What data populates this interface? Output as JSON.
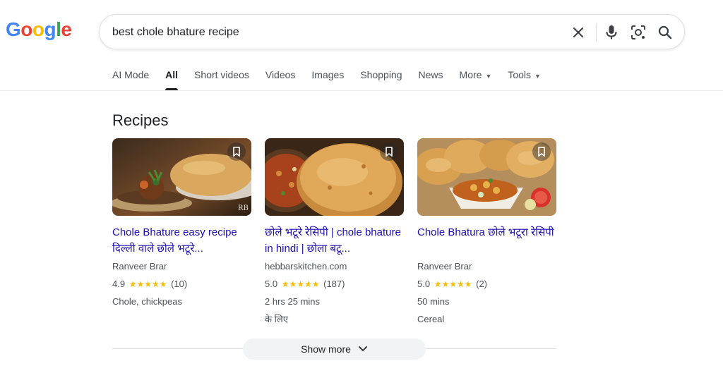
{
  "logo": {
    "text": "Google",
    "letters": [
      "G",
      "o",
      "o",
      "g",
      "l",
      "e"
    ],
    "colors": [
      "#4285F4",
      "#EA4335",
      "#FBBC05",
      "#4285F4",
      "#34A853",
      "#EA4335"
    ]
  },
  "search": {
    "value": "best chole bhature recipe",
    "icons": [
      "close-icon",
      "microphone-icon",
      "lens-icon",
      "search-icon"
    ]
  },
  "tabs": [
    {
      "label": "AI Mode",
      "active": false
    },
    {
      "label": "All",
      "active": true
    },
    {
      "label": "Short videos",
      "active": false
    },
    {
      "label": "Videos",
      "active": false
    },
    {
      "label": "Images",
      "active": false
    },
    {
      "label": "Shopping",
      "active": false
    },
    {
      "label": "News",
      "active": false
    },
    {
      "label": "More",
      "active": false,
      "dropdown": true
    },
    {
      "label": "Tools",
      "active": false,
      "dropdown": true
    }
  ],
  "recipes": {
    "title": "Recipes",
    "cards": [
      {
        "title": "Chole Bhature easy recipe दिल्ली वाले छोले भटूरे...",
        "source": "Ranveer Brar",
        "rating": "4.9",
        "stars": "★★★★★",
        "reviews": "(10)",
        "meta": [
          "Chole, chickpeas"
        ]
      },
      {
        "title": "छोले भटूरे रेसिपी | chole bhature in hindi | छोला बटू...",
        "source": "hebbarskitchen.com",
        "rating": "5.0",
        "stars": "★★★★★",
        "reviews": "(187)",
        "meta": [
          "2 hrs 25 mins",
          "के लिए"
        ]
      },
      {
        "title": "Chole Bhatura छोले भटूरा रेसिपी",
        "source": "Ranveer Brar",
        "rating": "5.0",
        "stars": "★★★★★",
        "reviews": "(2)",
        "meta": [
          "50 mins",
          "Cereal"
        ]
      }
    ],
    "show_more": "Show more"
  },
  "colors": {
    "link": "#1a0dab",
    "star": "#fbbc04",
    "muted": "#4d5156"
  }
}
